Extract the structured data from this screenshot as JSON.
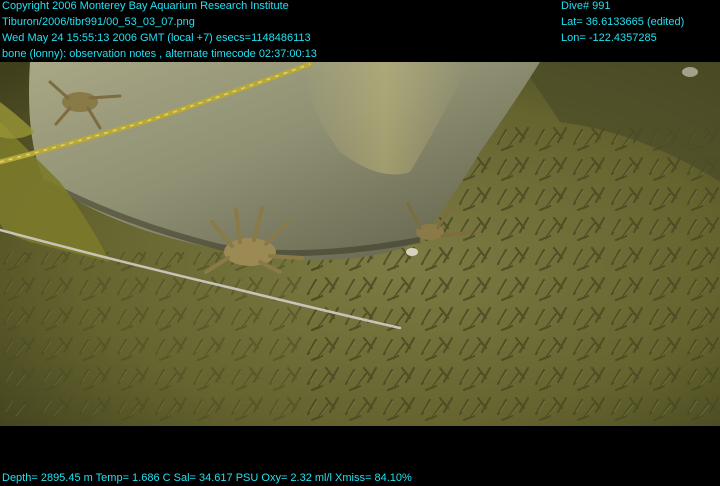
{
  "overlay": {
    "text_color": "#22e0f0",
    "top_left": [
      "Copyright 2006 Monterey Bay Aquarium Research Institute",
      "Tiburon/2006/tibr991/00_53_03_07.png",
      "Wed May 24 15:55:13 2006 GMT (local +7)  esecs=1148486113",
      "bone (lonny): observation notes , alternate timecode 02:37:00:13"
    ],
    "top_right": [
      "Dive# 991",
      "Lat= 36.6133665 (edited)",
      "Lon= -122.4357285"
    ],
    "bottom": "Depth= 2895.45 m  Temp= 1.686 C  Sal= 34.617 PSU  Oxy= 2.32 ml/l  Xmiss= 84.10%"
  },
  "scene": {
    "sediment_color": "#6b6a34",
    "bone_color": "#8e8e70",
    "rope_color": "#b8a838"
  }
}
